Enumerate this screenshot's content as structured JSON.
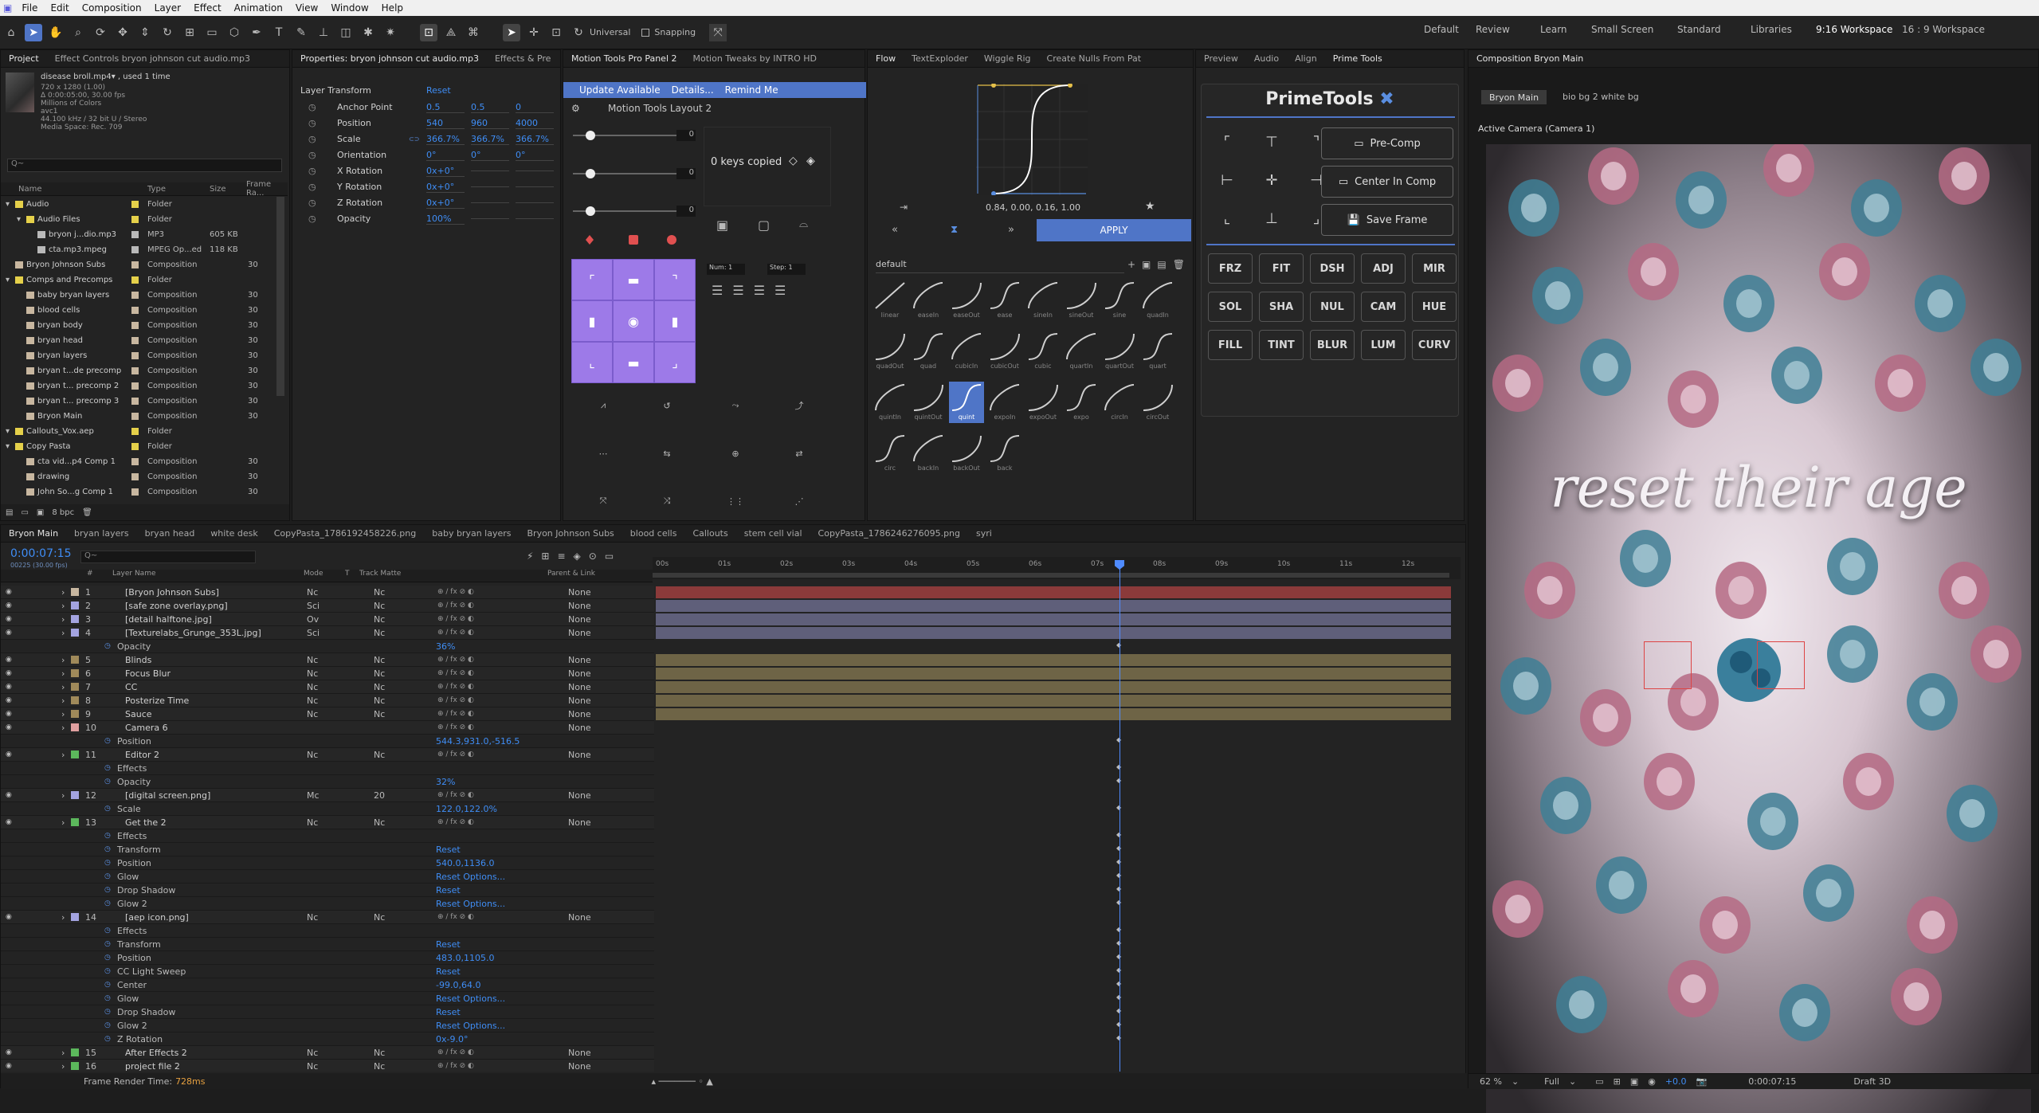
{
  "menu": [
    "File",
    "Edit",
    "Composition",
    "Layer",
    "Effect",
    "Animation",
    "View",
    "Window",
    "Help"
  ],
  "toolbar": {
    "universal": "Universal",
    "snapping": "Snapping"
  },
  "workspaces": [
    "Default",
    "Review",
    "Learn",
    "Small Screen",
    "Standard",
    "Libraries",
    "9:16 Workspace",
    "16 : 9 Workspace"
  ],
  "project": {
    "tabs": [
      "Project",
      "Effect Controls bryon johnson cut audio.mp3"
    ],
    "item_name": "disease broll.mp4▾ , used 1 time",
    "item_info": [
      "720 x 1280 (1.00)",
      "Δ 0:00:05:00, 30.00 fps",
      "Millions of Colors",
      "avc1",
      "44.100 kHz / 32 bit U / Stereo",
      "Media Space: Rec. 709"
    ],
    "cols": [
      "Name",
      "Type",
      "Size",
      "Frame Ra..."
    ],
    "rows": [
      {
        "name": "Audio",
        "type": "Folder",
        "size": "",
        "fr": "",
        "indent": 0,
        "color": "#e5d04a"
      },
      {
        "name": "Audio Files",
        "type": "Folder",
        "size": "",
        "fr": "",
        "indent": 1,
        "color": "#e5d04a"
      },
      {
        "name": "bryon j...dio.mp3",
        "type": "MP3",
        "size": "605 KB",
        "fr": "",
        "indent": 2,
        "color": "#b9b9b9"
      },
      {
        "name": "cta.mp3.mpeg",
        "type": "MPEG Op...ed",
        "size": "118 KB",
        "fr": "",
        "indent": 2,
        "color": "#b9b9b9"
      },
      {
        "name": "Bryon Johnson Subs",
        "type": "Composition",
        "size": "",
        "fr": "30",
        "indent": 0,
        "color": "#c8b7a0"
      },
      {
        "name": "Comps and Precomps",
        "type": "Folder",
        "size": "",
        "fr": "",
        "indent": 0,
        "color": "#e5d04a"
      },
      {
        "name": "baby bryan layers",
        "type": "Composition",
        "size": "",
        "fr": "30",
        "indent": 1,
        "color": "#c8b7a0"
      },
      {
        "name": "blood cells",
        "type": "Composition",
        "size": "",
        "fr": "30",
        "indent": 1,
        "color": "#c8b7a0"
      },
      {
        "name": "bryan body",
        "type": "Composition",
        "size": "",
        "fr": "30",
        "indent": 1,
        "color": "#c8b7a0"
      },
      {
        "name": "bryan head",
        "type": "Composition",
        "size": "",
        "fr": "30",
        "indent": 1,
        "color": "#c8b7a0"
      },
      {
        "name": "bryan layers",
        "type": "Composition",
        "size": "",
        "fr": "30",
        "indent": 1,
        "color": "#c8b7a0"
      },
      {
        "name": "bryan t...de precomp",
        "type": "Composition",
        "size": "",
        "fr": "30",
        "indent": 1,
        "color": "#c8b7a0"
      },
      {
        "name": "bryan t... precomp 2",
        "type": "Composition",
        "size": "",
        "fr": "30",
        "indent": 1,
        "color": "#c8b7a0"
      },
      {
        "name": "bryan t... precomp 3",
        "type": "Composition",
        "size": "",
        "fr": "30",
        "indent": 1,
        "color": "#c8b7a0"
      },
      {
        "name": "Bryon Main",
        "type": "Composition",
        "size": "",
        "fr": "30",
        "indent": 1,
        "color": "#c8b7a0"
      },
      {
        "name": "Callouts_Vox.aep",
        "type": "Folder",
        "size": "",
        "fr": "",
        "indent": 0,
        "color": "#e5d04a"
      },
      {
        "name": "Copy Pasta",
        "type": "Folder",
        "size": "",
        "fr": "",
        "indent": 0,
        "color": "#e5d04a"
      },
      {
        "name": "cta vid...p4 Comp 1",
        "type": "Composition",
        "size": "",
        "fr": "30",
        "indent": 1,
        "color": "#c8b7a0"
      },
      {
        "name": "drawing",
        "type": "Composition",
        "size": "",
        "fr": "30",
        "indent": 1,
        "color": "#c8b7a0"
      },
      {
        "name": "John So...g Comp 1",
        "type": "Composition",
        "size": "",
        "fr": "30",
        "indent": 1,
        "color": "#c8b7a0"
      }
    ],
    "bpc": "8 bpc"
  },
  "properties": {
    "tabs": [
      "Properties: bryon johnson cut audio.mp3",
      "Effects & Pre"
    ],
    "section": "Layer Transform",
    "reset": "Reset",
    "rows": [
      {
        "label": "Anchor Point",
        "v1": "0.5",
        "v2": "0.5",
        "v3": "0"
      },
      {
        "label": "Position",
        "v1": "540",
        "v2": "960",
        "v3": "4000"
      },
      {
        "label": "Scale",
        "v1": "366.7%",
        "v2": "366.7%",
        "v3": "366.7%"
      },
      {
        "label": "Orientation",
        "v1": "0°",
        "v2": "0°",
        "v3": "0°"
      },
      {
        "label": "X Rotation",
        "v1": "0x+0°",
        "v2": "",
        "v3": ""
      },
      {
        "label": "Y Rotation",
        "v1": "0x+0°",
        "v2": "",
        "v3": ""
      },
      {
        "label": "Z Rotation",
        "v1": "0x+0°",
        "v2": "",
        "v3": ""
      },
      {
        "label": "Opacity",
        "v1": "100%",
        "v2": "",
        "v3": ""
      }
    ]
  },
  "motion": {
    "tabs": [
      "Motion Tools Pro Panel 2",
      "Motion Tweaks by INTRO HD"
    ],
    "update": "Update Available",
    "details": "Details...",
    "remind": "Remind Me",
    "layout": "Motion Tools Layout 2",
    "keys": "0 keys copied",
    "num": "Num: 1",
    "step": "Step: 1",
    "zero": "0"
  },
  "flow": {
    "tabs": [
      "Flow",
      "TextExploder",
      "Wiggle Rig",
      "Create Nulls From Pat"
    ],
    "values": "0.84, 0.00, 0.16, 1.00",
    "apply": "APPLY",
    "preset": "default",
    "curves": [
      "linear",
      "easeIn",
      "easeOut",
      "ease",
      "sineIn",
      "sineOut",
      "sine",
      "quadIn",
      "quadOut",
      "quad",
      "cubicIn",
      "cubicOut",
      "cubic",
      "quartIn",
      "quartOut",
      "quart",
      "quintIn",
      "quintOut",
      "quint",
      "expoIn",
      "expoOut",
      "expo",
      "circIn",
      "circOut",
      "circ",
      "backIn",
      "backOut",
      "back"
    ]
  },
  "prime": {
    "tabs": [
      "Preview",
      "Audio",
      "Align",
      "Prime Tools"
    ],
    "title": "PrimeTools",
    "precomp": "Pre-Comp",
    "center": "Center In Comp",
    "save": "Save Frame",
    "buttons": [
      "FRZ",
      "FIT",
      "DSH",
      "ADJ",
      "MIR",
      "SOL",
      "SHA",
      "NUL",
      "CAM",
      "HUE",
      "FILL",
      "TINT",
      "BLUR",
      "LUM",
      "CURV"
    ]
  },
  "viewer": {
    "tab": "Composition Bryon Main",
    "crumbs": [
      "Bryon Main",
      "bio bg 2 white bg"
    ],
    "camera": "Active Camera (Camera 1)",
    "caption": "reset their age",
    "zoom": "62 %",
    "quality": "Full",
    "time": "0:00:07:15",
    "draft": "Draft 3D",
    "exposure": "+0.0"
  },
  "timeline": {
    "tabs": [
      "Bryon Main",
      "bryan layers",
      "bryan head",
      "white desk",
      "CopyPasta_1786192458226.png",
      "baby bryan layers",
      "Bryon Johnson Subs",
      "blood cells",
      "Callouts",
      "stem cell vial",
      "CopyPasta_1786246276095.png",
      "syri"
    ],
    "time": "0:00:07:15",
    "fps": "00225 (30.00 fps)",
    "search": "Q~",
    "cols": [
      "#",
      "Layer Name",
      "Mode",
      "T",
      "Track Matte",
      "Parent & Link"
    ],
    "ticks": [
      "00s",
      "01s",
      "02s",
      "03s",
      "04s",
      "05s",
      "06s",
      "07s",
      "08s",
      "09s",
      "10s",
      "11s",
      "12s"
    ],
    "render": "Frame Render Time:",
    "render_val": "728ms",
    "rows": [
      {
        "n": "1",
        "name": "[Bryon Johnson Subs]",
        "mode": "Nc",
        "tm": "Nc",
        "parent": "None",
        "color": "#c8b7a0",
        "bar": "#8b3a3a",
        "type": "layer"
      },
      {
        "n": "2",
        "name": "[safe zone overlay.png]",
        "mode": "Sci",
        "tm": "Nc",
        "parent": "None",
        "color": "#a3a3e0",
        "bar": "#5f5f7a",
        "type": "layer"
      },
      {
        "n": "3",
        "name": "[detail halftone.jpg]",
        "mode": "Ov",
        "tm": "Nc",
        "parent": "None",
        "color": "#a3a3e0",
        "bar": "#5f5f7a",
        "type": "layer"
      },
      {
        "n": "4",
        "name": "[Texturelabs_Grunge_353L.jpg]",
        "mode": "Sci",
        "tm": "Nc",
        "parent": "None",
        "color": "#a3a3e0",
        "bar": "#5f5f7a",
        "type": "layer"
      },
      {
        "n": "",
        "name": "Opacity",
        "val": "36%",
        "type": "prop"
      },
      {
        "n": "5",
        "name": "Blinds",
        "mode": "Nc",
        "tm": "Nc",
        "parent": "None",
        "color": "#a08a5a",
        "bar": "#6e6446",
        "type": "layer"
      },
      {
        "n": "6",
        "name": "Focus Blur",
        "mode": "Nc",
        "tm": "Nc",
        "parent": "None",
        "color": "#a08a5a",
        "bar": "#6e6446",
        "type": "layer"
      },
      {
        "n": "7",
        "name": "CC",
        "mode": "Nc",
        "tm": "Nc",
        "parent": "None",
        "color": "#a08a5a",
        "bar": "#6e6446",
        "type": "layer"
      },
      {
        "n": "8",
        "name": "Posterize Time",
        "mode": "Nc",
        "tm": "Nc",
        "parent": "None",
        "color": "#a08a5a",
        "bar": "#6e6446",
        "type": "layer"
      },
      {
        "n": "9",
        "name": "Sauce",
        "mode": "Nc",
        "tm": "Nc",
        "parent": "None",
        "color": "#a08a5a",
        "bar": "#6e6446",
        "type": "layer"
      },
      {
        "n": "10",
        "name": "Camera 6",
        "mode": "",
        "tm": "",
        "parent": "None",
        "color": "#e0a0a0",
        "bar": "",
        "type": "layer"
      },
      {
        "n": "",
        "name": "Position",
        "val": "544.3,931.0,-516.5",
        "type": "prop"
      },
      {
        "n": "11",
        "name": "Editor 2",
        "mode": "Nc",
        "tm": "Nc",
        "parent": "None",
        "color": "#5cb85c",
        "bar": "",
        "type": "layer"
      },
      {
        "n": "",
        "name": "Effects",
        "val": "",
        "type": "prop"
      },
      {
        "n": "",
        "name": "Opacity",
        "val": "32%",
        "type": "prop"
      },
      {
        "n": "12",
        "name": "[digital screen.png]",
        "mode": "Mc",
        "tm": "20",
        "parent": "None",
        "color": "#a3a3e0",
        "bar": "",
        "type": "layer"
      },
      {
        "n": "",
        "name": "Scale",
        "val": "122.0,122.0%",
        "type": "prop"
      },
      {
        "n": "13",
        "name": "Get the 2",
        "mode": "Nc",
        "tm": "Nc",
        "parent": "None",
        "color": "#5cb85c",
        "bar": "",
        "type": "layer"
      },
      {
        "n": "",
        "name": "Effects",
        "val": "",
        "type": "prop"
      },
      {
        "n": "",
        "name": "Transform",
        "val": "Reset",
        "type": "prop"
      },
      {
        "n": "",
        "name": "Position",
        "val": "540.0,1136.0",
        "type": "prop"
      },
      {
        "n": "",
        "name": "Glow",
        "val": "Reset  Options...",
        "type": "prop"
      },
      {
        "n": "",
        "name": "Drop Shadow",
        "val": "Reset",
        "type": "prop"
      },
      {
        "n": "",
        "name": "Glow 2",
        "val": "Reset  Options...",
        "type": "prop"
      },
      {
        "n": "14",
        "name": "[aep icon.png]",
        "mode": "Nc",
        "tm": "Nc",
        "parent": "None",
        "color": "#a3a3e0",
        "bar": "",
        "type": "layer"
      },
      {
        "n": "",
        "name": "Effects",
        "val": "",
        "type": "prop"
      },
      {
        "n": "",
        "name": "Transform",
        "val": "Reset",
        "type": "prop"
      },
      {
        "n": "",
        "name": "Position",
        "val": "483.0,1105.0",
        "type": "prop"
      },
      {
        "n": "",
        "name": "CC Light Sweep",
        "val": "Reset",
        "type": "prop"
      },
      {
        "n": "",
        "name": "Center",
        "val": "-99.0,64.0",
        "type": "prop"
      },
      {
        "n": "",
        "name": "Glow",
        "val": "Reset  Options...",
        "type": "prop"
      },
      {
        "n": "",
        "name": "Drop Shadow",
        "val": "Reset",
        "type": "prop"
      },
      {
        "n": "",
        "name": "Glow 2",
        "val": "Reset  Options...",
        "type": "prop"
      },
      {
        "n": "",
        "name": "Z Rotation",
        "val": "0x-9.0°",
        "type": "prop"
      },
      {
        "n": "15",
        "name": "After Effects 2",
        "mode": "Nc",
        "tm": "Nc",
        "parent": "None",
        "color": "#5cb85c",
        "bar": "",
        "type": "layer"
      },
      {
        "n": "16",
        "name": "project file 2",
        "mode": "Nc",
        "tm": "Nc",
        "parent": "None",
        "color": "#5cb85c",
        "bar": "",
        "type": "layer"
      }
    ]
  }
}
